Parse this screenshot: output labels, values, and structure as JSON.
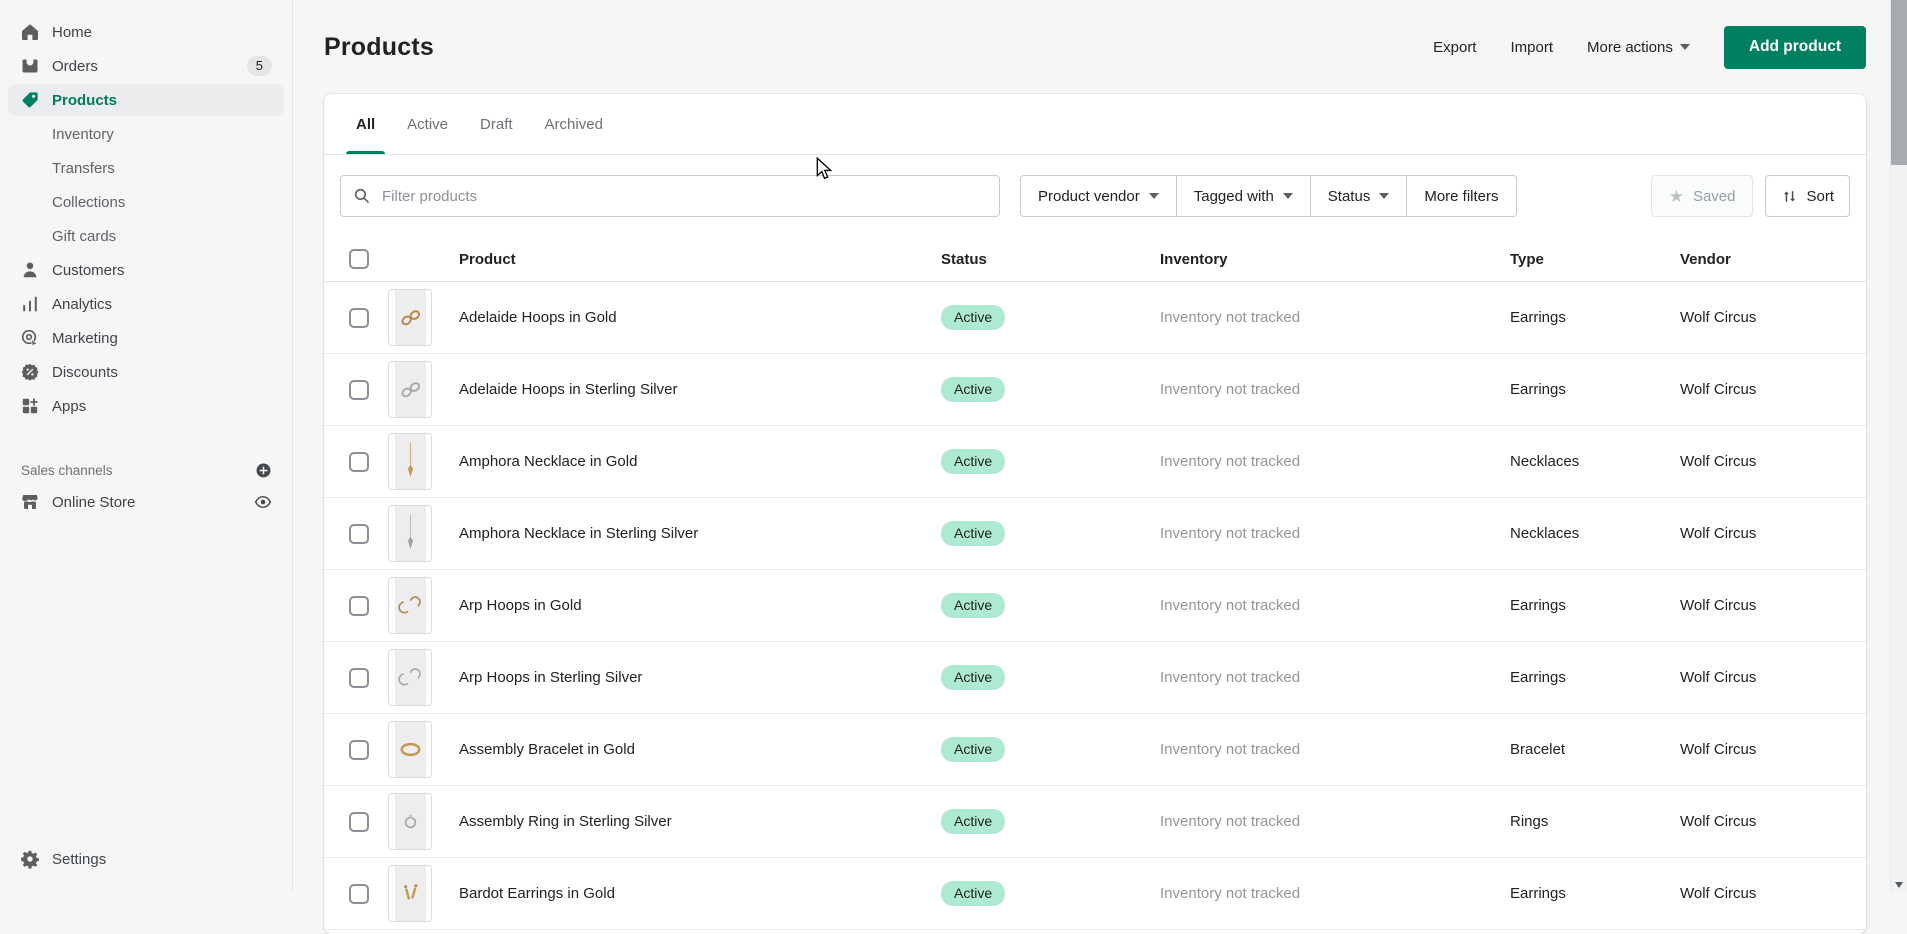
{
  "sidebar": {
    "items": [
      {
        "label": "Home",
        "icon": "home-icon"
      },
      {
        "label": "Orders",
        "icon": "orders-icon",
        "badge": "5"
      },
      {
        "label": "Products",
        "icon": "products-icon",
        "selected": true
      },
      {
        "label": "Inventory",
        "sub": true
      },
      {
        "label": "Transfers",
        "sub": true
      },
      {
        "label": "Collections",
        "sub": true
      },
      {
        "label": "Gift cards",
        "sub": true
      },
      {
        "label": "Customers",
        "icon": "customers-icon"
      },
      {
        "label": "Analytics",
        "icon": "analytics-icon"
      },
      {
        "label": "Marketing",
        "icon": "marketing-icon"
      },
      {
        "label": "Discounts",
        "icon": "discounts-icon"
      },
      {
        "label": "Apps",
        "icon": "apps-icon"
      }
    ],
    "sales_channels": {
      "label": "Sales channels",
      "channels": [
        {
          "label": "Online Store",
          "icon": "store-icon"
        }
      ]
    },
    "settings_label": "Settings"
  },
  "header": {
    "title": "Products",
    "export_label": "Export",
    "import_label": "Import",
    "more_actions_label": "More actions",
    "add_product_label": "Add product"
  },
  "tabs": [
    {
      "label": "All",
      "active": true
    },
    {
      "label": "Active"
    },
    {
      "label": "Draft"
    },
    {
      "label": "Archived"
    }
  ],
  "filters": {
    "search_placeholder": "Filter products",
    "buttons": [
      {
        "label": "Product vendor",
        "caret": true
      },
      {
        "label": "Tagged with",
        "caret": true
      },
      {
        "label": "Status",
        "caret": true
      },
      {
        "label": "More filters",
        "caret": false
      }
    ],
    "saved_label": "Saved",
    "sort_label": "Sort"
  },
  "table": {
    "columns": [
      "Product",
      "Status",
      "Inventory",
      "Type",
      "Vendor"
    ],
    "rows": [
      {
        "product": "Adelaide Hoops in Gold",
        "status": "Active",
        "inventory": "Inventory not tracked",
        "type": "Earrings",
        "vendor": "Wolf Circus",
        "image": "hoops-gold"
      },
      {
        "product": "Adelaide Hoops in Sterling Silver",
        "status": "Active",
        "inventory": "Inventory not tracked",
        "type": "Earrings",
        "vendor": "Wolf Circus",
        "image": "hoops-silver"
      },
      {
        "product": "Amphora Necklace in Gold",
        "status": "Active",
        "inventory": "Inventory not tracked",
        "type": "Necklaces",
        "vendor": "Wolf Circus",
        "image": "necklace-gold"
      },
      {
        "product": "Amphora Necklace in Sterling Silver",
        "status": "Active",
        "inventory": "Inventory not tracked",
        "type": "Necklaces",
        "vendor": "Wolf Circus",
        "image": "necklace-silver"
      },
      {
        "product": "Arp Hoops in Gold",
        "status": "Active",
        "inventory": "Inventory not tracked",
        "type": "Earrings",
        "vendor": "Wolf Circus",
        "image": "arp-gold"
      },
      {
        "product": "Arp Hoops in Sterling Silver",
        "status": "Active",
        "inventory": "Inventory not tracked",
        "type": "Earrings",
        "vendor": "Wolf Circus",
        "image": "arp-silver"
      },
      {
        "product": "Assembly Bracelet in Gold",
        "status": "Active",
        "inventory": "Inventory not tracked",
        "type": "Bracelet",
        "vendor": "Wolf Circus",
        "image": "bracelet-gold"
      },
      {
        "product": "Assembly Ring in Sterling Silver",
        "status": "Active",
        "inventory": "Inventory not tracked",
        "type": "Rings",
        "vendor": "Wolf Circus",
        "image": "ring-silver"
      },
      {
        "product": "Bardot Earrings in Gold",
        "status": "Active",
        "inventory": "Inventory not tracked",
        "type": "Earrings",
        "vendor": "Wolf Circus",
        "image": "earrings-gold"
      }
    ]
  },
  "colors": {
    "accent_green": "#008060",
    "selected_nav_text": "#007b5c",
    "badge_background": "#aee9d1"
  }
}
